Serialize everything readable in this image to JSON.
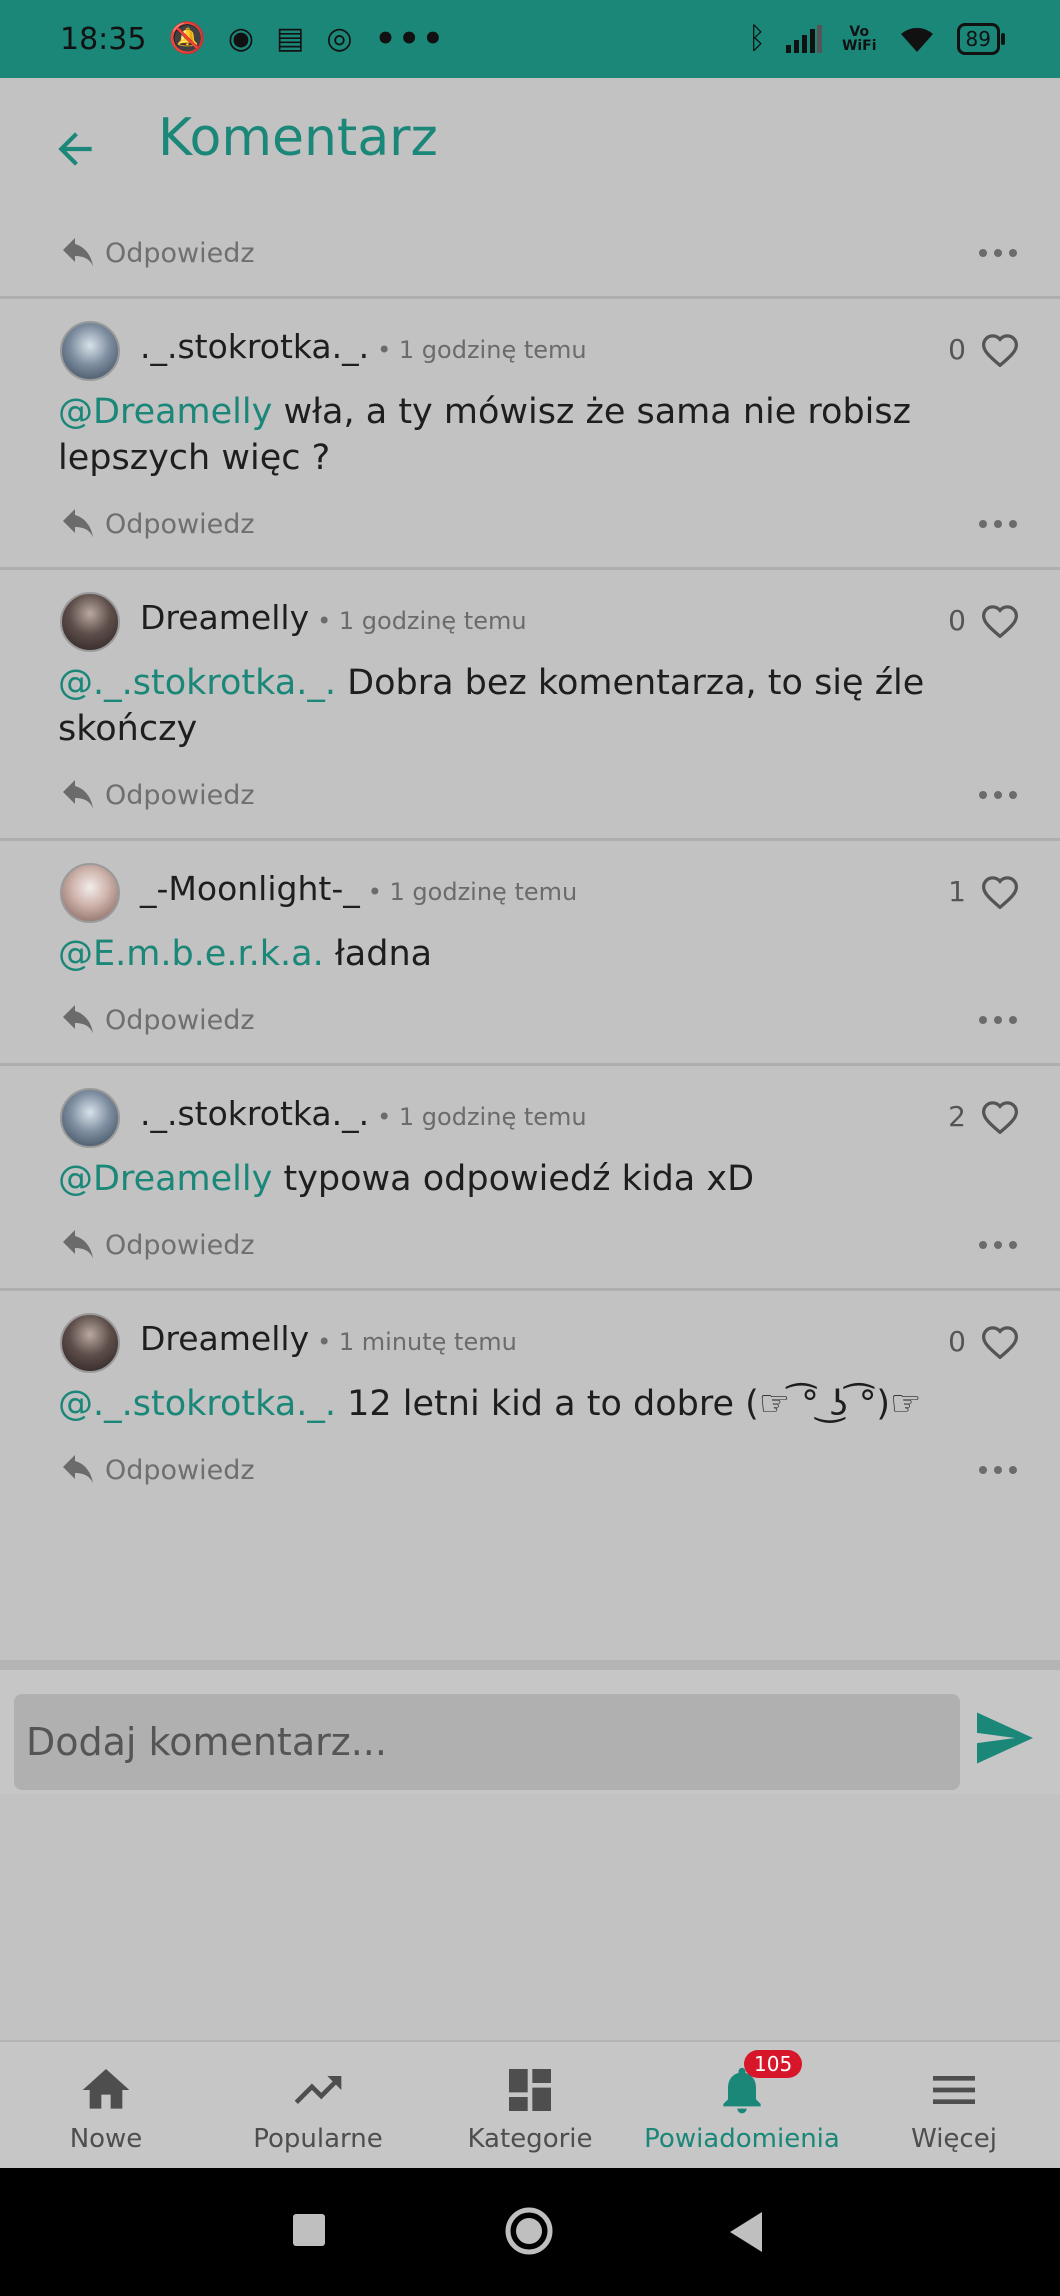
{
  "status_bar": {
    "time": "18:35",
    "vowifi": "Vo\nWiFi",
    "battery": "89",
    "more": "•••"
  },
  "app_bar": {
    "title": "Komentarz"
  },
  "comments": [
    {
      "username": "._.stokrotka._.",
      "time": "• 1 godzinę temu",
      "likes": "0",
      "mention": "@Dreamelly",
      "text": " wła, a ty mówisz że sama nie robisz lepszych więc ?",
      "avatar": "stok"
    },
    {
      "username": "Dreamelly",
      "time": "• 1 godzinę temu",
      "likes": "0",
      "mention": "@._.stokrotka._.",
      "text": " Dobra bez komentarza, to się źle skończy",
      "avatar": "dream"
    },
    {
      "username": "_-Moonlight-_",
      "time": "• 1 godzinę temu",
      "likes": "1",
      "mention": "@E.m.b.e.r.k.a.",
      "text": " ładna",
      "avatar": "moon"
    },
    {
      "username": "._.stokrotka._.",
      "time": "• 1 godzinę temu",
      "likes": "2",
      "mention": "@Dreamelly",
      "text": " typowa odpowiedź kida xD",
      "avatar": "stok"
    },
    {
      "username": "Dreamelly",
      "time": "• 1 minutę temu",
      "likes": "0",
      "mention": "@._.stokrotka._.",
      "text": " 12 letni kid a to dobre (☞ ͡° ͜ʖ ͡°)☞",
      "avatar": "dream"
    }
  ],
  "reply_label": "Odpowiedz",
  "composer": {
    "placeholder": "Dodaj komentarz..."
  },
  "bottom_nav": {
    "items": [
      {
        "label": "Nowe",
        "icon": "home-icon"
      },
      {
        "label": "Popularne",
        "icon": "trending-icon"
      },
      {
        "label": "Kategorie",
        "icon": "dashboard-icon"
      },
      {
        "label": "Powiadomienia",
        "icon": "bell-icon",
        "badge": "105",
        "active": true
      },
      {
        "label": "Więcej",
        "icon": "menu-icon"
      }
    ]
  },
  "colors": {
    "accent": "#1a8779",
    "badge": "#d8162a"
  }
}
